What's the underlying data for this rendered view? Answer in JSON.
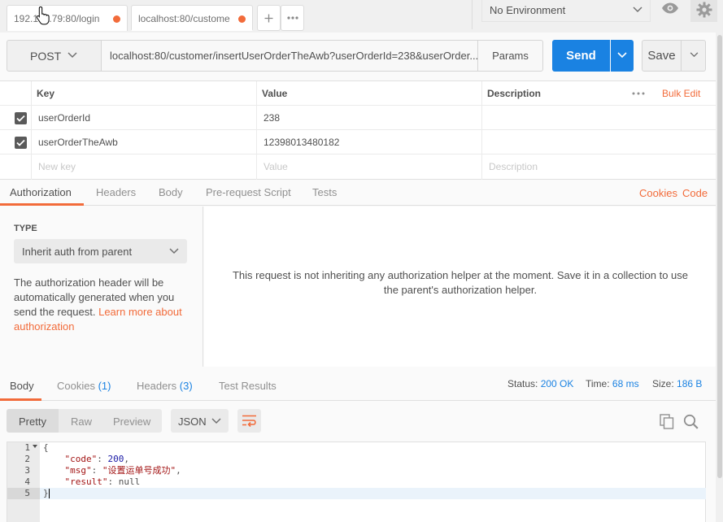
{
  "tabs": [
    {
      "label": "192.168.79:80/login"
    },
    {
      "label": "localhost:80/custome"
    }
  ],
  "environment": {
    "selected": "No Environment"
  },
  "request": {
    "method": "POST",
    "url": "localhost:80/customer/insertUserOrderTheAwb?userOrderId=238&userOrder...",
    "params_label": "Params",
    "send_label": "Send",
    "save_label": "Save"
  },
  "params_table": {
    "headers": {
      "key": "Key",
      "value": "Value",
      "description": "Description",
      "bulk_edit": "Bulk Edit"
    },
    "rows": [
      {
        "key": "userOrderId",
        "value": "238",
        "description": "",
        "checked": true
      },
      {
        "key": "userOrderTheAwb",
        "value": "12398013480182",
        "description": "",
        "checked": true
      }
    ],
    "placeholders": {
      "key": "New key",
      "value": "Value",
      "description": "Description"
    }
  },
  "sub_tabs": {
    "items": [
      "Authorization",
      "Headers",
      "Body",
      "Pre-request Script",
      "Tests"
    ],
    "active": "Authorization",
    "cookies": "Cookies",
    "code": "Code"
  },
  "auth": {
    "type_label": "TYPE",
    "type_value": "Inherit auth from parent",
    "description": "The authorization header will be automatically generated when you send the request.",
    "learn_more": "Learn more about authorization",
    "message": "This request is not inheriting any authorization helper at the moment. Save it in a collection to use the parent's authorization helper."
  },
  "response": {
    "tabs": {
      "body": "Body",
      "cookies": "Cookies",
      "cookies_count": "(1)",
      "headers": "Headers",
      "headers_count": "(3)",
      "test_results": "Test Results"
    },
    "status_label": "Status:",
    "status_value": "200 OK",
    "time_label": "Time:",
    "time_value": "68 ms",
    "size_label": "Size:",
    "size_value": "186 B",
    "view_modes": [
      "Pretty",
      "Raw",
      "Preview"
    ],
    "active_view": "Pretty",
    "format": "JSON",
    "line_numbers": [
      "1",
      "2",
      "3",
      "4",
      "5"
    ],
    "code": {
      "open": "{",
      "code_key": "\"code\"",
      "code_value": "200",
      "msg_key": "\"msg\"",
      "msg_value": "\"设置运单号成功\"",
      "result_key": "\"result\"",
      "result_value": "null",
      "close": "}"
    }
  },
  "icons": [
    "cursor-hand-icon",
    "plus-icon",
    "more-icon",
    "chevron-down-icon",
    "eye-icon",
    "gear-icon",
    "check-icon",
    "wrap-icon",
    "copy-icon",
    "search-icon"
  ],
  "colors": {
    "accent": "#f26b3a",
    "primary": "#1a82e2"
  }
}
